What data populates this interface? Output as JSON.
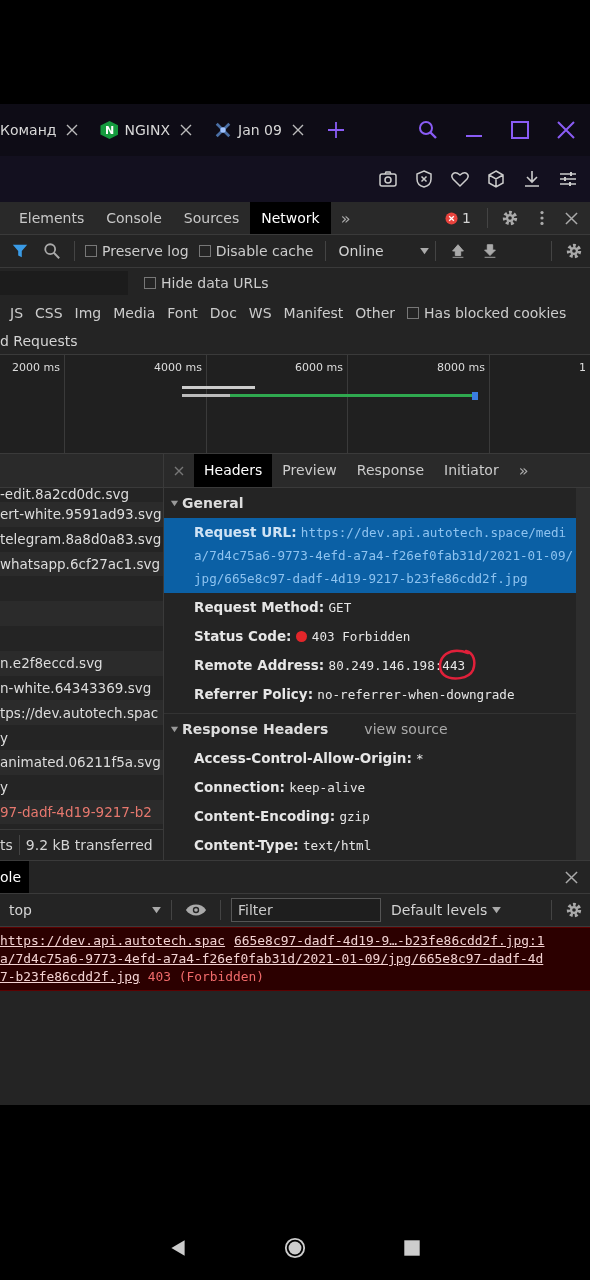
{
  "browser_tabs": [
    {
      "title": "Команд",
      "kind": "page"
    },
    {
      "title": "NGINX",
      "kind": "nginx",
      "logo": "N"
    },
    {
      "title": "Jan 09",
      "kind": "spark"
    }
  ],
  "devtools": {
    "tabs": [
      {
        "label": "Elements",
        "selected": false
      },
      {
        "label": "Console",
        "selected": false
      },
      {
        "label": "Sources",
        "selected": false
      },
      {
        "label": "Network",
        "selected": true
      }
    ],
    "more": "»",
    "error_count": "1"
  },
  "network_toolbar": {
    "filter_active": true,
    "preserve_log": {
      "label": "Preserve log",
      "checked": false
    },
    "disable_cache": {
      "label": "Disable cache",
      "checked": false
    },
    "throttling": "Online"
  },
  "filter_row": {
    "hide_data_urls": {
      "label": "Hide data URLs",
      "checked": false
    }
  },
  "types": [
    {
      "label": "JS",
      "selected": false
    },
    {
      "label": "CSS",
      "selected": false
    },
    {
      "label": "Img",
      "selected": false
    },
    {
      "label": "Media",
      "selected": false
    },
    {
      "label": "Font",
      "selected": false
    },
    {
      "label": "Doc",
      "selected": false
    },
    {
      "label": "WS",
      "selected": false
    },
    {
      "label": "Manifest",
      "selected": false
    },
    {
      "label": "Other",
      "selected": false
    }
  ],
  "has_blocked_cookies": {
    "label": "Has blocked cookies",
    "checked": false
  },
  "blocked_requests_label": "d Requests",
  "timeline": {
    "ticks": [
      "2000 ms",
      "4000 ms",
      "6000 ms",
      "8000 ms",
      "1"
    ]
  },
  "requests": [
    {
      "name": "-edit.8a2cd0dc.svg",
      "failed": false
    },
    {
      "name": "ert-white.9591ad93.svg",
      "failed": false
    },
    {
      "name": "telegram.8a8d0a83.svg",
      "failed": false
    },
    {
      "name": "whatsapp.6cf27ac1.svg",
      "failed": false
    },
    {
      "name": "n.e2f8eccd.svg",
      "failed": false
    },
    {
      "name": "n-white.64343369.svg",
      "failed": false
    },
    {
      "name": "tps://dev.autotech.spac",
      "failed": false
    },
    {
      "name": "y",
      "failed": false
    },
    {
      "name": "animated.06211f5a.svg",
      "failed": false
    },
    {
      "name": "y",
      "failed": false
    },
    {
      "name": "97-dadf-4d19-9217-b2",
      "failed": true
    }
  ],
  "status_bar": {
    "requests": "ts",
    "transferred": "9.2 kB transferred"
  },
  "details": {
    "tabs": [
      {
        "label": "Headers",
        "selected": true
      },
      {
        "label": "Preview",
        "selected": false
      },
      {
        "label": "Response",
        "selected": false
      },
      {
        "label": "Initiator",
        "selected": false
      }
    ],
    "more": "»",
    "sections": [
      {
        "title": "General",
        "expanded": true,
        "rows": [
          {
            "name": "Request URL:",
            "value": "https://dev.api.autotech.space/media/7d4c75a6-9773-4efd-a7a4-f26ef0fab31d/2021-01-09/jpg/665e8c97-dadf-4d19-9217-b23fe86cdd2f.jpg",
            "selected": true,
            "status_dot": false,
            "circled": false
          },
          {
            "name": "Request Method:",
            "value": "GET",
            "selected": false,
            "status_dot": false,
            "circled": false
          },
          {
            "name": "Status Code:",
            "value": "403 Forbidden",
            "selected": false,
            "status_dot": true,
            "circled": false
          },
          {
            "name": "Remote Address:",
            "value": "80.249.146.198:443",
            "selected": false,
            "status_dot": false,
            "circled": true
          },
          {
            "name": "Referrer Policy:",
            "value": "no-referrer-when-downgrade",
            "selected": false,
            "status_dot": false,
            "circled": false
          }
        ]
      },
      {
        "title": "Response Headers",
        "expanded": true,
        "link": "view source",
        "rows": [
          {
            "name": "Access-Control-Allow-Origin:",
            "value": "*",
            "selected": false,
            "status_dot": false,
            "circled": false
          },
          {
            "name": "Connection:",
            "value": "keep-alive",
            "selected": false,
            "status_dot": false,
            "circled": false
          },
          {
            "name": "Content-Encoding:",
            "value": "gzip",
            "selected": false,
            "status_dot": false,
            "circled": false
          },
          {
            "name": "Content-Type:",
            "value": "text/html",
            "selected": false,
            "status_dot": false,
            "circled": false
          }
        ]
      }
    ]
  },
  "console": {
    "drawer_tab": {
      "label": "ole",
      "selected": true
    },
    "context": "top",
    "filter_placeholder": "Filter",
    "levels": "Default levels",
    "message": {
      "url_lines": [
        "https://dev.api.autotech.spac",
        "a/7d4c75a6-9773-4efd-a7a4-f26ef0fab31d/2021-01-09/jpg/665e8c97-dadf-4d",
        "7-b23fe86cdd2f.jpg"
      ],
      "source": "665e8c97-dadf-4d19-9…-b23fe86cdd2f.jpg:1",
      "status": "403 (Forbidden)"
    }
  }
}
